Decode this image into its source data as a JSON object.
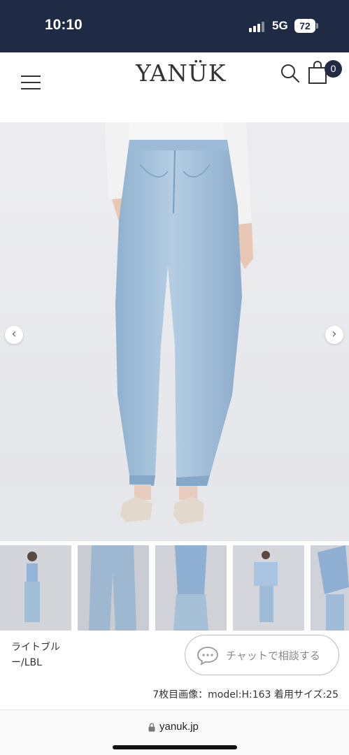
{
  "status_bar": {
    "time": "10:10",
    "network": "5G",
    "battery": "72"
  },
  "header": {
    "logo": "YANÜK",
    "cart_count": "0"
  },
  "gallery": {
    "prev_arrow": "‹",
    "next_arrow": "›"
  },
  "product": {
    "color_label": "ライトブルー/LBL"
  },
  "chat": {
    "label": "チャットで相談する"
  },
  "caption": "7枚目画像：model:H:163 着用サイズ:25",
  "browser": {
    "url": "yanuk.jp"
  },
  "colors": {
    "status_bar_bg": "#1f2a44",
    "badge_bg": "#232b44",
    "denim": "#9fbfda"
  },
  "icons": [
    "menu-icon",
    "search-icon",
    "cart-icon",
    "chevron-left-icon",
    "chevron-right-icon",
    "chat-bubble-icon",
    "lock-icon"
  ]
}
